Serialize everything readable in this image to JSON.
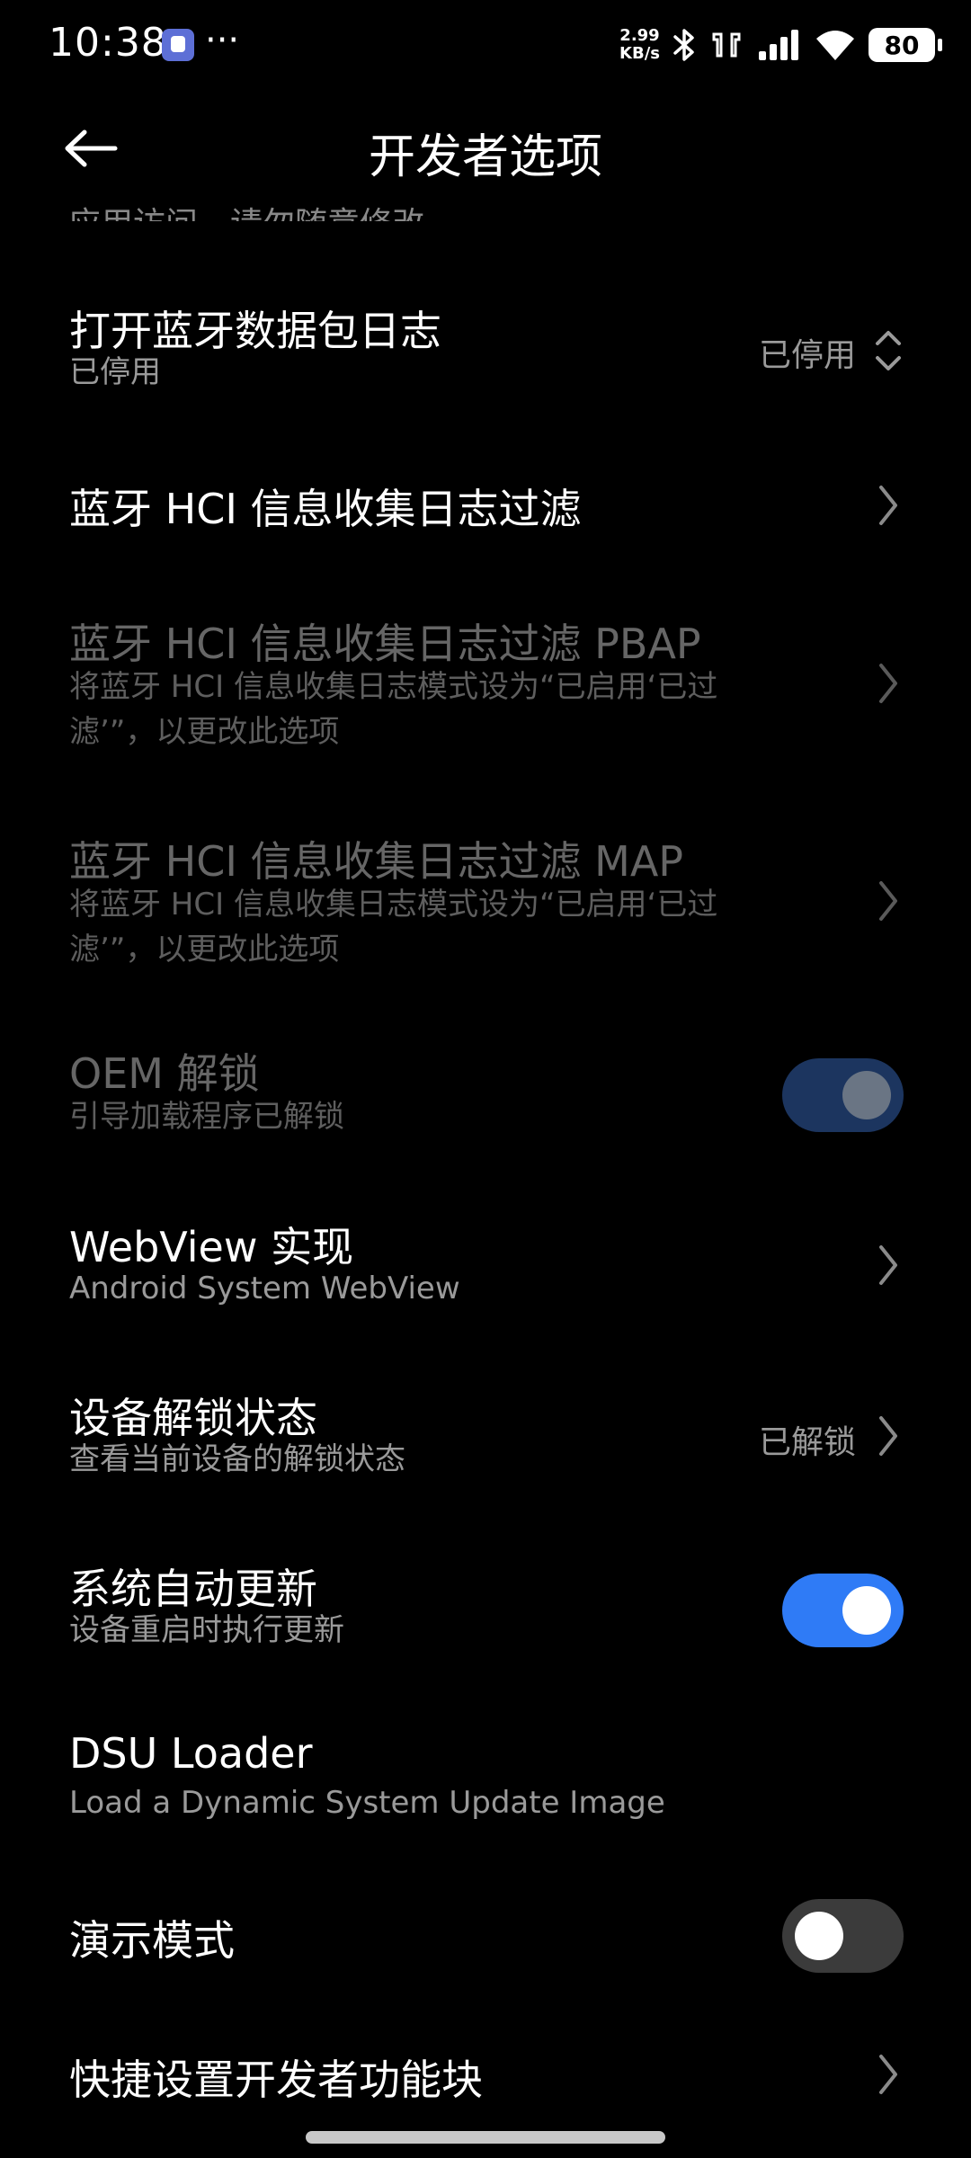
{
  "status_bar": {
    "time": "10:38",
    "more": "···",
    "net_speed_value": "2.99",
    "net_speed_unit": "KB/s",
    "battery": "80",
    "icons": [
      "app-notification-icon",
      "bluetooth-icon",
      "earbuds-icon",
      "signal-icon",
      "wifi-icon",
      "battery-icon"
    ]
  },
  "header": {
    "title": "开发者选项",
    "back_icon": "arrow-left-icon",
    "cut_off_text": "应用访问，请勿随意修改"
  },
  "rows": [
    {
      "title": "打开蓝牙数据包日志",
      "subtitle": "已停用",
      "value": "已停用",
      "control": "dropdown",
      "disabled": false
    },
    {
      "title": "蓝牙 HCI 信息收集日志过滤",
      "control": "chevron",
      "disabled": false
    },
    {
      "title": "蓝牙 HCI 信息收集日志过滤 PBAP",
      "subtitle_line1": "将蓝牙 HCI 信息收集日志模式设为“已启用‘已过",
      "subtitle_line2": "滤’”，以更改此选项",
      "control": "chevron",
      "disabled": true
    },
    {
      "title": "蓝牙 HCI 信息收集日志过滤 MAP",
      "subtitle_line1": "将蓝牙 HCI 信息收集日志模式设为“已启用‘已过",
      "subtitle_line2": "滤’”，以更改此选项",
      "control": "chevron",
      "disabled": true
    },
    {
      "title": "OEM 解锁",
      "subtitle": "引导加载程序已解锁",
      "control": "switch",
      "checked": true,
      "disabled": true
    },
    {
      "title": "WebView 实现",
      "subtitle": "Android System WebView",
      "control": "chevron",
      "disabled": false
    },
    {
      "title": "设备解锁状态",
      "subtitle": "查看当前设备的解锁状态",
      "value": "已解锁",
      "control": "chevron",
      "disabled": false
    },
    {
      "title": "系统自动更新",
      "subtitle": "设备重启时执行更新",
      "control": "switch",
      "checked": true,
      "disabled": false
    },
    {
      "title": "DSU Loader",
      "subtitle": "Load a Dynamic System Update Image",
      "control": "none",
      "disabled": false
    },
    {
      "title": "演示模式",
      "control": "switch",
      "checked": false,
      "disabled": false
    },
    {
      "title": "快捷设置开发者功能块",
      "control": "chevron",
      "disabled": false
    }
  ],
  "colors": {
    "background": "#000000",
    "switch_on": "#2f7bf6",
    "switch_on_disabled": "#1c355f",
    "switch_off": "#3b3b3b",
    "disabled_text": "#666666",
    "secondary_text": "#9a9a9a"
  }
}
